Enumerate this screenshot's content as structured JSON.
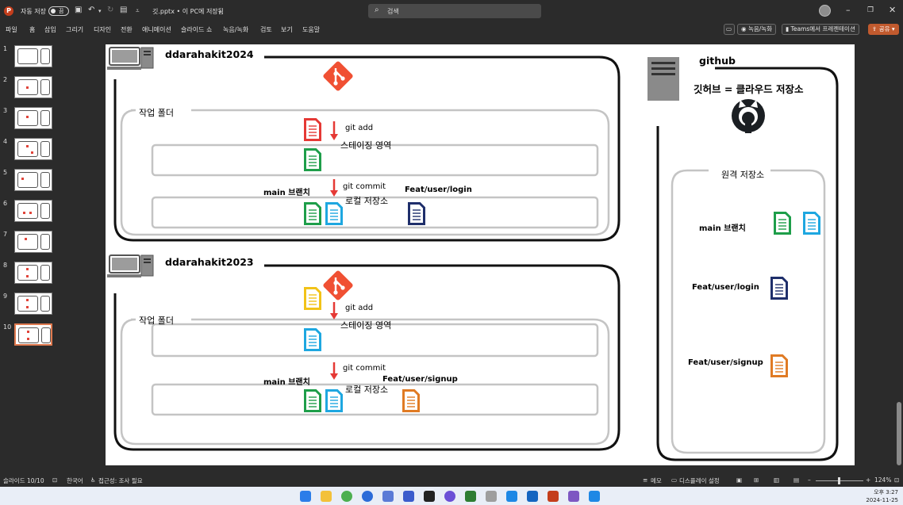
{
  "titlebar": {
    "autosave_label": "자동 저장",
    "autosave_state": "끔",
    "doc_title": "깃.pptx • 이 PC에 저장됨",
    "search_placeholder": "검색"
  },
  "menu": [
    "파일",
    "홈",
    "삽입",
    "그리기",
    "디자인",
    "전환",
    "애니메이션",
    "슬라이드 쇼",
    "녹음/녹화",
    "검토",
    "보기",
    "도움말"
  ],
  "ribbon_right": {
    "record_label": "녹음/녹화",
    "teams_label": "Teams에서 프레젠테이션",
    "share_label": "공유"
  },
  "thumbnails": [
    "1",
    "2",
    "3",
    "4",
    "5",
    "6",
    "7",
    "8",
    "9",
    "10"
  ],
  "slide": {
    "pc1": {
      "name": "ddarahakit2024",
      "work_folder": "작업 폴더",
      "git_add": "git add",
      "staging": "스테이징 영역",
      "git_commit": "git commit",
      "local_repo": "로컬 저장소",
      "main_branch": "main 브랜치",
      "feat_branch": "Feat/user/login"
    },
    "pc2": {
      "name": "ddarahakit2023",
      "work_folder": "작업 폴더",
      "git_add": "git add",
      "staging": "스테이징 영역",
      "git_commit": "git commit",
      "local_repo": "로컬 저장소",
      "main_branch": "main 브랜치",
      "feat_branch": "Feat/user/signup"
    },
    "github": {
      "name": "github",
      "caption": "깃허브 = 클라우드 저장소",
      "remote": "원격 저장소",
      "main_branch": "main 브랜치",
      "feat_login": "Feat/user/login",
      "feat_signup": "Feat/user/signup"
    },
    "colors": {
      "red": "#e53935",
      "green": "#1e9e4a",
      "blue": "#1ea7e0",
      "navy": "#1f2f6b",
      "orange": "#e07b24",
      "yellow": "#f2c318",
      "git_orange": "#f05033"
    }
  },
  "statusbar": {
    "slide_info": "슬라이드 10/10",
    "language": "한국어",
    "accessibility": "접근성: 조사 필요",
    "notes": "메모",
    "display_settings": "디스플레이 설정",
    "zoom": "124%"
  },
  "clock": {
    "time": "오후 3:27",
    "date": "2024-11-25"
  }
}
